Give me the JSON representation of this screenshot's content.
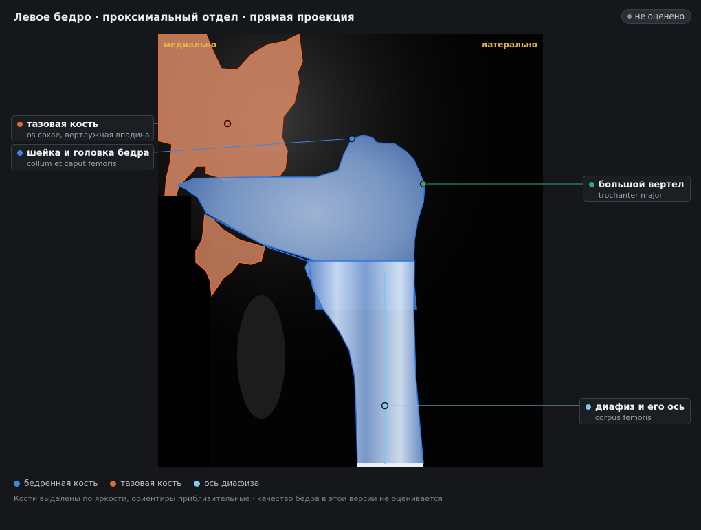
{
  "header": {
    "title": "Левое бедро · проксимальный отдел · прямая проекция",
    "status_badge": "не оценено"
  },
  "image": {
    "side_left": "медиально",
    "side_right": "латерально"
  },
  "landmarks": [
    {
      "name": "тазовая кость",
      "latin": "os coxae, вертлужная впадина",
      "color": "#e0683a"
    },
    {
      "name": "шейка и головка бедра",
      "latin": "collum et caput femoris",
      "color": "#3d86e6"
    },
    {
      "name": "большой вертел",
      "latin": "trochanter major",
      "color": "#2fa87a"
    },
    {
      "name": "диафиз и его ось",
      "latin": "corpus femoris",
      "color": "#7cc8ee"
    }
  ],
  "legend": [
    {
      "label": "бедренная кость",
      "color": "#3d86e6"
    },
    {
      "label": "тазовая кость",
      "color": "#e0683a"
    },
    {
      "label": "ось диафиза",
      "color": "#7cc8ee"
    }
  ],
  "footnote": "Кости выделены по яркости, ориентиры приблизительные · качество бедра в этой версии не оценивается"
}
